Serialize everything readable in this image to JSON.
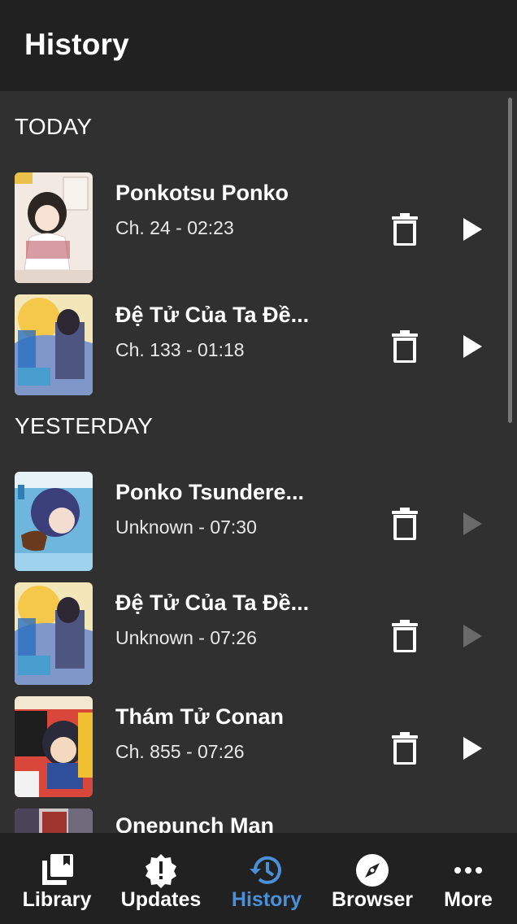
{
  "header": {
    "title": "History"
  },
  "sections": [
    {
      "label": "TODAY"
    },
    {
      "label": "YESTERDAY"
    }
  ],
  "items": [
    {
      "title": "Ponkotsu Ponko",
      "subtitle": "Ch. 24 - 02:23",
      "resume_enabled": true
    },
    {
      "title": "Đệ Tử Của Ta Đề...",
      "subtitle": "Ch. 133 - 01:18",
      "resume_enabled": true
    },
    {
      "title": "Ponko Tsundere...",
      "subtitle": "Unknown - 07:30",
      "resume_enabled": false
    },
    {
      "title": "Đệ Tử Của Ta Đề...",
      "subtitle": "Unknown - 07:26",
      "resume_enabled": false
    },
    {
      "title": "Thám Tử Conan",
      "subtitle": "Ch. 855 - 07:26",
      "resume_enabled": true
    },
    {
      "title": "Onepunch Man",
      "subtitle": "",
      "resume_enabled": true
    }
  ],
  "nav": {
    "active": "History",
    "items": [
      {
        "label": "Library",
        "icon": "library-icon"
      },
      {
        "label": "Updates",
        "icon": "updates-icon"
      },
      {
        "label": "History",
        "icon": "history-icon"
      },
      {
        "label": "Browser",
        "icon": "compass-icon"
      },
      {
        "label": "More",
        "icon": "more-dots-icon"
      }
    ]
  },
  "colors": {
    "accent": "#4a90d9",
    "background": "#303030",
    "bars": "#212121"
  }
}
